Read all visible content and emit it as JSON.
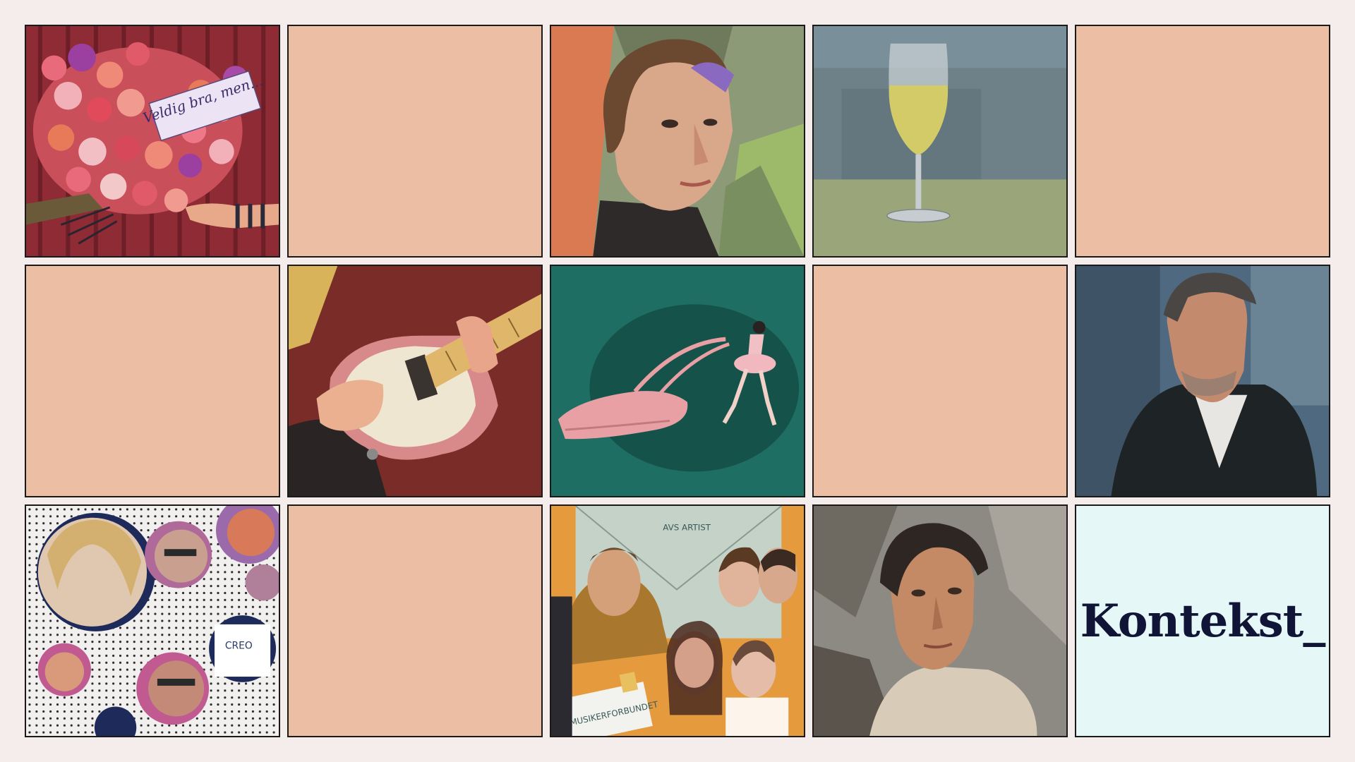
{
  "tiles": {
    "flowers_note": "Veldig bra, men...",
    "creo_label": "CREO",
    "letter_label": "AVS ARTIST",
    "envelope_label": "MUSIKERFORBUNDET"
  },
  "brand": {
    "logo_text": "Kontekst_"
  },
  "colors": {
    "background": "#f5ecec",
    "blank_tile": "#ecbfa4",
    "logo_tile": "#e6f7f8",
    "logo_text": "#101436"
  }
}
